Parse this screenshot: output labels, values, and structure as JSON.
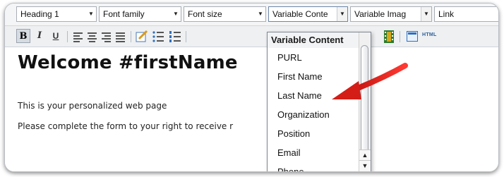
{
  "toolbar": {
    "dropdowns": {
      "format": "Heading 1",
      "font_family": "Font family",
      "font_size": "Font size",
      "variable_content": "Variable Conte",
      "variable_image": "Variable Imag",
      "link": "Link"
    },
    "buttons": {
      "bold": "B",
      "italic": "I",
      "underline": "U",
      "html": "HTML"
    }
  },
  "editor": {
    "heading": "Welcome #firstName",
    "paragraphs": [
      "This is your personalized web page",
      "Please complete the form to your right to receive r"
    ]
  },
  "variable_menu": {
    "title": "Variable Content",
    "items": [
      "PURL",
      "First Name",
      "Last Name",
      "Organization",
      "Position",
      "Email",
      "Phone"
    ]
  },
  "annotation": {
    "arrow_color": "#e0201c"
  }
}
